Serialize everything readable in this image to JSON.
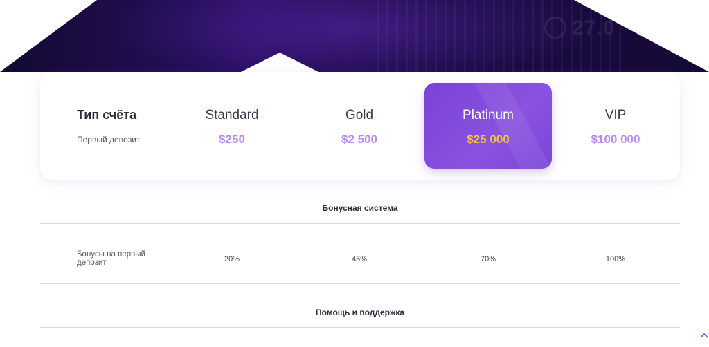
{
  "hero": {
    "watermark_text": "27.0"
  },
  "account_card": {
    "title": "Тип счёта",
    "subtitle": "Первый депозит",
    "plans": [
      {
        "name": "Standard",
        "price": "$250",
        "active": false
      },
      {
        "name": "Gold",
        "price": "$2 500",
        "active": false
      },
      {
        "name": "Platinum",
        "price": "$25 000",
        "active": true
      },
      {
        "name": "VIP",
        "price": "$100 000",
        "active": false
      }
    ]
  },
  "sections": {
    "bonus": {
      "title": "Бонусная система",
      "row_label": "Бонусы на первый депозит",
      "values": [
        "20%",
        "45%",
        "70%",
        "100%"
      ]
    },
    "support": {
      "title": "Помощь и поддержка"
    }
  },
  "colors": {
    "accent": "#8a52e0",
    "price": "#b98bf2",
    "active_price": "#f7c43d",
    "hero_bg": "#1d0b47"
  },
  "icons": {
    "scroll_up": "chevron-up-icon"
  }
}
